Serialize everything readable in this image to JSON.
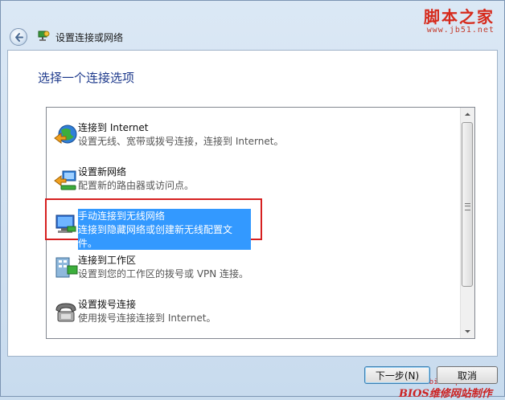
{
  "window": {
    "title": "设置连接或网络",
    "watermark_main": "脚本之家",
    "watermark_url": "www.jb51.net"
  },
  "main": {
    "heading": "选择一个连接选项",
    "options": [
      {
        "title": "连接到 Internet",
        "desc": "设置无线、宽带或拨号连接，连接到 Internet。",
        "icon": "globe-icon"
      },
      {
        "title": "设置新网络",
        "desc": "配置新的路由器或访问点。",
        "icon": "router-icon"
      },
      {
        "title": "手动连接到无线网络",
        "desc": "连接到隐藏网络或创建新无线配置文件。",
        "icon": "wireless-icon"
      },
      {
        "title": "连接到工作区",
        "desc": "设置到您的工作区的拨号或 VPN 连接。",
        "icon": "workplace-icon"
      },
      {
        "title": "设置拨号连接",
        "desc": "使用拨号连接连接到 Internet。",
        "icon": "phone-icon"
      }
    ],
    "selected_index": 2
  },
  "bios_watermark": {
    "url": "www.biosrepair.com",
    "name": "BIOS维修网站制作"
  },
  "buttons": {
    "next_label": "下一步(N)",
    "cancel_label": "取消"
  },
  "colors": {
    "selection": "#3399ff",
    "highlight_frame": "#d62020",
    "heading": "#1e3a8c"
  }
}
